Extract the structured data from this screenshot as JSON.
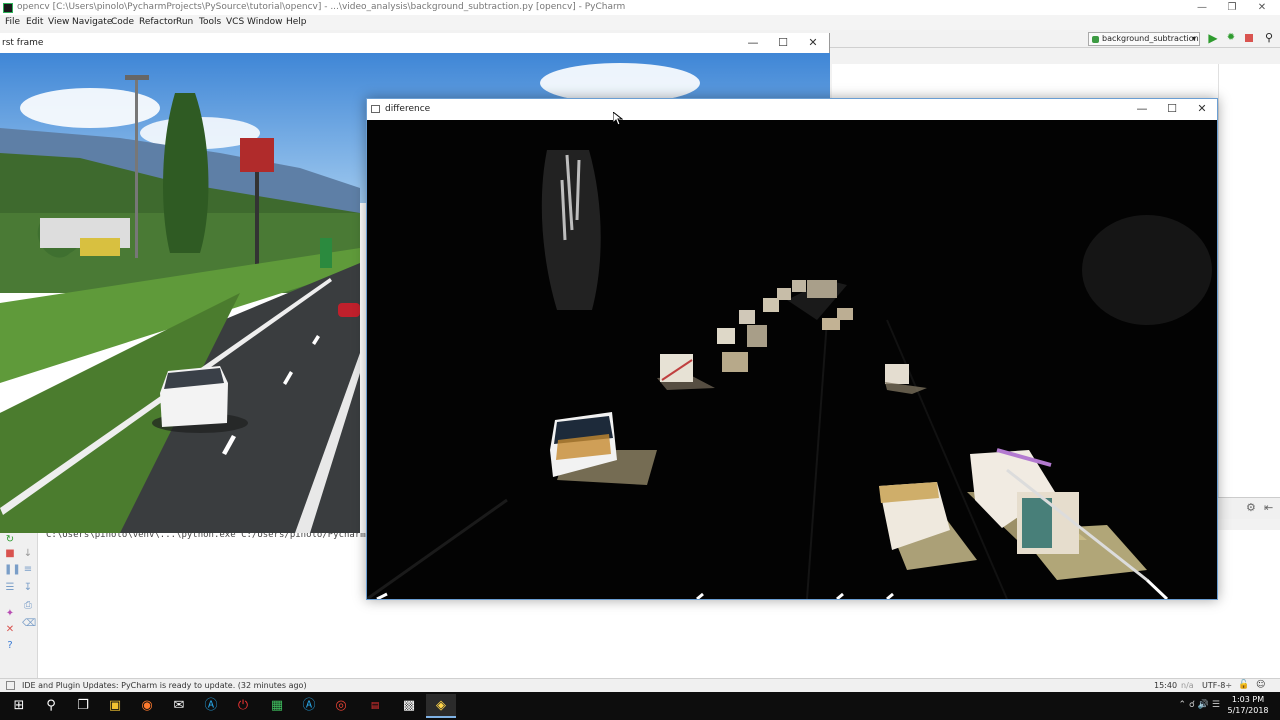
{
  "window": {
    "title": "opencv [C:\\Users\\pinolo\\PycharmProjects\\PySource\\tutorial\\opencv] - ...\\video_analysis\\background_subtraction.py [opencv] - PyCharm"
  },
  "menu": [
    "File",
    "Edit",
    "View",
    "Navigate",
    "Code",
    "Refactor",
    "Run",
    "Tools",
    "VCS",
    "Window",
    "Help"
  ],
  "toolbar": {
    "run_config": "background_subtraction",
    "run_icon": "play-icon",
    "debug_icon": "bug-icon",
    "stop_icon": "stop-icon",
    "search_icon": "search-icon"
  },
  "run_panel": {
    "output_text": "C:\\Users\\pinolo\\venv\\...\\python.exe C:/Users/pinolo/PycharmProjects/PySource/tutorial/opencv/..."
  },
  "opencv_windows": {
    "first_frame_title": "rst frame",
    "difference_title": "difference"
  },
  "statusbar": {
    "message": "IDE and Plugin Updates: PyCharm is ready to update. (32 minutes ago)",
    "position": "15:40",
    "line_sep": "n/a",
    "encoding": "UTF-8÷"
  },
  "taskbar": {
    "time": "1:03 PM",
    "date": "5/17/2018"
  },
  "colors": {
    "accent": "#6a9ed3",
    "run_green": "#2e9b2e",
    "stop_red": "#d9534f"
  }
}
